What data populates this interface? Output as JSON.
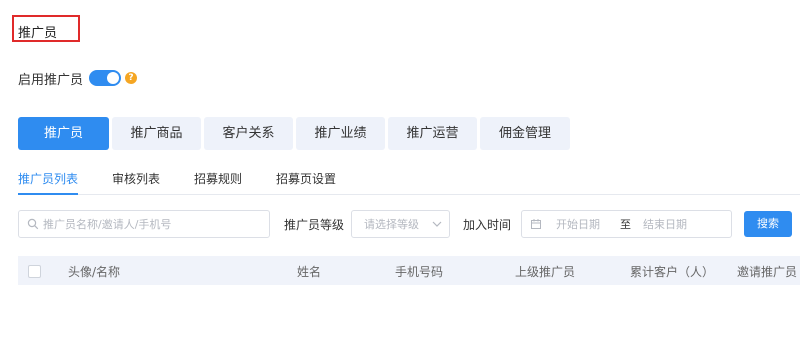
{
  "page": {
    "title": "推广员"
  },
  "enable": {
    "label": "启用推广员",
    "enabled": true,
    "help_icon": "question-icon",
    "help_glyph": "?"
  },
  "main_tabs": [
    "推广员",
    "推广商品",
    "客户关系",
    "推广业绩",
    "推广运营",
    "佣金管理"
  ],
  "sub_tabs": [
    "推广员列表",
    "审核列表",
    "招募规则",
    "招募页设置"
  ],
  "filters": {
    "search_placeholder": "推广员名称/邀请人/手机号",
    "level_label": "推广员等级",
    "level_placeholder": "请选择等级",
    "join_label": "加入时间",
    "start_placeholder": "开始日期",
    "range_sep": "至",
    "end_placeholder": "结束日期",
    "search_button": "搜索"
  },
  "table": {
    "columns": [
      "头像/名称",
      "姓名",
      "手机号码",
      "上级推广员",
      "累计客户（人）",
      "邀请推广员"
    ]
  },
  "colors": {
    "accent": "#2f8cf0",
    "highlight_border": "#e02a2a",
    "help": "#f5a623",
    "tab_bg": "#eef2fa",
    "header_bg": "#f0f3fa"
  }
}
